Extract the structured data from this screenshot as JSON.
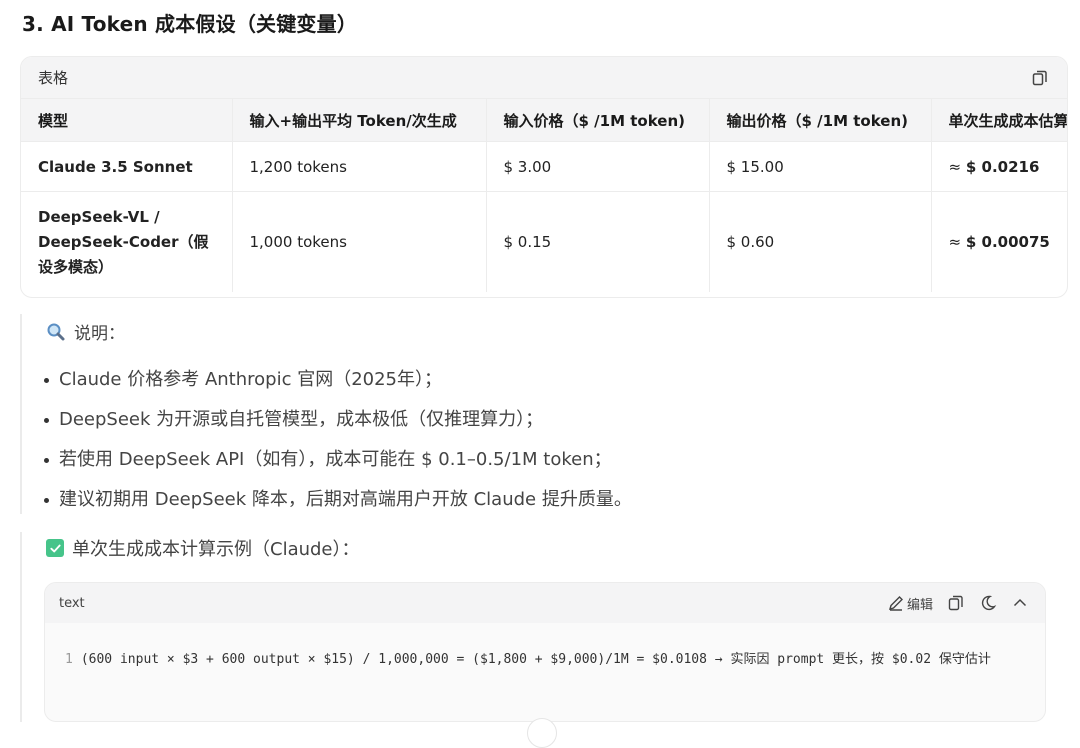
{
  "heading": "3. AI Token 成本假设（关键变量）",
  "table": {
    "label": "表格",
    "columns": [
      "模型",
      "输入+输出平均 Token/次生成",
      "输入价格（$ /1M token)",
      "输出价格（$ /1M token)",
      "单次生成成本估算"
    ],
    "rows": [
      [
        "Claude 3.5 Sonnet",
        "1,200 tokens",
        "$ 3.00",
        "$ 15.00",
        "≈ ",
        "$ 0.0216"
      ],
      [
        "DeepSeek-VL / DeepSeek-Coder（假设多模态）",
        "1,000 tokens",
        "$ 0.15",
        "$ 0.60",
        "≈ ",
        "$ 0.00075"
      ]
    ]
  },
  "notes": {
    "title": "说明：",
    "items": [
      "Claude 价格参考 Anthropic 官网（2025年）；",
      "DeepSeek 为开源或自托管模型，成本极低（仅推理算力）；",
      "若使用 DeepSeek API（如有），成本可能在 $ 0.1–0.5/1M token；",
      "建议初期用 DeepSeek 降本，后期对高端用户开放 Claude 提升质量。"
    ]
  },
  "example": {
    "title": "单次生成成本计算示例（Claude）：",
    "code_lang": "text",
    "edit_label": "编辑",
    "line_number": "1",
    "code": "(600 input × $3 + 600 output × $15) / 1,000,000 = ($1,800 + $9,000)/1M = $0.0108 → 实际因 prompt 更长，按 $0.02 保守估计"
  },
  "icons": {
    "copy": "copy-icon",
    "magnifier": "magnifier-icon",
    "check": "check-icon",
    "edit": "pencil-icon",
    "theme": "moon-icon",
    "collapse": "chevron-up-icon"
  },
  "colors": {
    "check_green": "#46c48a",
    "header_bg": "#f4f4f5"
  }
}
